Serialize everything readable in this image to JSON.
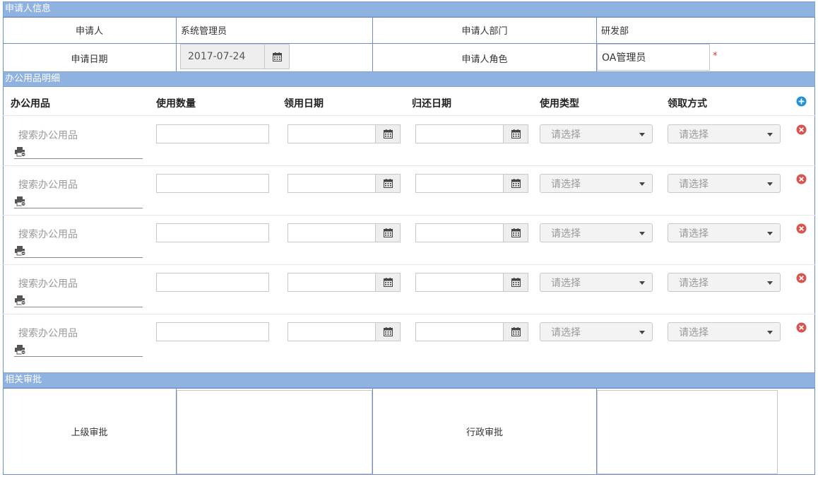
{
  "applicant_section": {
    "title": "申请人信息",
    "applicant_label": "申请人",
    "applicant_value": "系统管理员",
    "dept_label": "申请人部门",
    "dept_value": "研发部",
    "date_label": "申请日期",
    "date_value": "2017-07-24",
    "role_label": "申请人角色",
    "role_value": "OA管理员",
    "required_mark": "*"
  },
  "supplies_section": {
    "title": "办公用品明细",
    "columns": [
      "办公用品",
      "使用数量",
      "领用日期",
      "归还日期",
      "使用类型",
      "领取方式"
    ],
    "search_placeholder": "搜索办公用品",
    "select_placeholder": "请选择",
    "row_count": 5
  },
  "approval_section": {
    "title": "相关审批",
    "supervisor_label": "上级审批",
    "admin_label": "行政审批"
  },
  "icons": {
    "add": "plus-circle-icon",
    "remove": "close-circle-icon",
    "calendar": "calendar-icon",
    "printer": "printer-icon"
  },
  "colors": {
    "header_bg": "#8fb2e1",
    "border": "#6d8fc9",
    "add_icon": "#1e90d6",
    "remove_icon": "#d9534f"
  }
}
